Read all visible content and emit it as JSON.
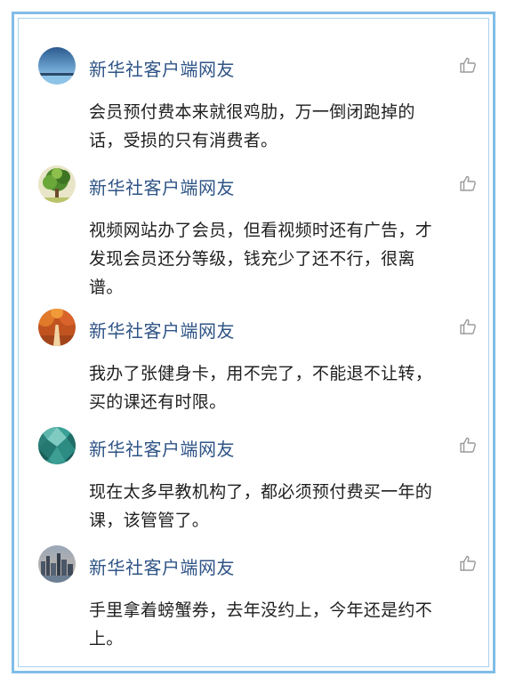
{
  "comments": [
    {
      "username": "新华社客户端网友",
      "text": "会员预付费本来就很鸡肋，万一倒闭跑掉的话，受损的只有消费者。",
      "avatar_icon": "lake-scenery-avatar",
      "like_icon": "thumbs-up-icon"
    },
    {
      "username": "新华社客户端网友",
      "text": "视频网站办了会员，但看视频时还有广告，才发现会员还分等级，钱充少了还不行，很离谱。",
      "avatar_icon": "green-tree-avatar",
      "like_icon": "thumbs-up-icon"
    },
    {
      "username": "新华社客户端网友",
      "text": "我办了张健身卡，用不完了，不能退不让转，买的课还有时限。",
      "avatar_icon": "autumn-road-avatar",
      "like_icon": "thumbs-up-icon"
    },
    {
      "username": "新华社客户端网友",
      "text": "现在太多早教机构了，都必须预付费买一年的课，该管管了。",
      "avatar_icon": "teal-polygon-avatar",
      "like_icon": "thumbs-up-icon"
    },
    {
      "username": "新华社客户端网友",
      "text": "手里拿着螃蟹券，去年没约上，今年还是约不上。",
      "avatar_icon": "city-skyline-avatar",
      "like_icon": "thumbs-up-icon"
    }
  ],
  "colors": {
    "frame_border": "#7fbde8",
    "username": "#2f5486",
    "text": "#1f1f1f",
    "icon": "#9a9a9a"
  }
}
